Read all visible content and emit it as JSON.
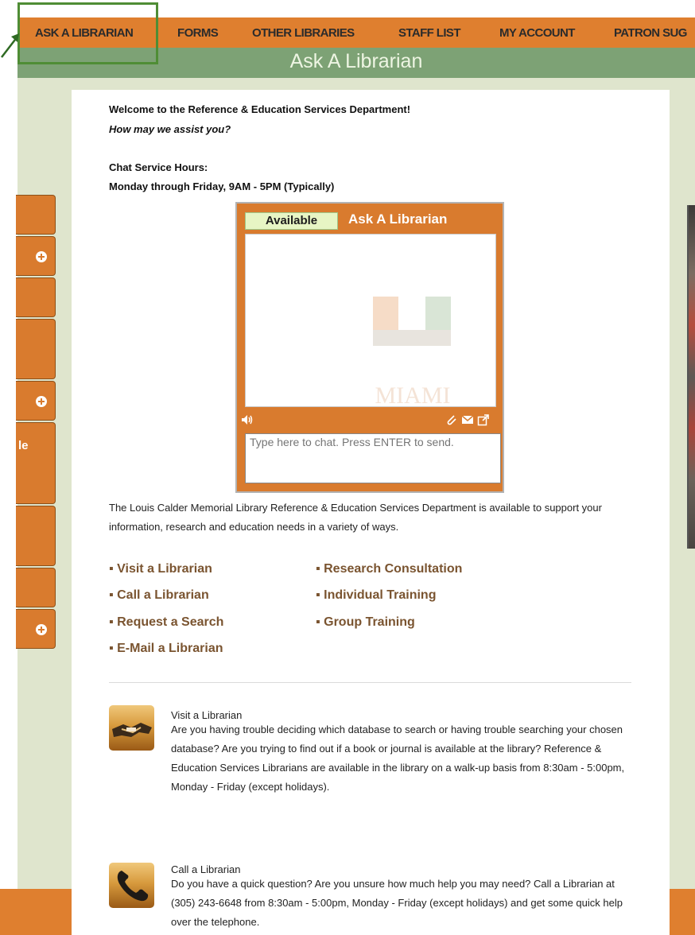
{
  "nav": {
    "items": [
      "ASK A LIBRARIAN",
      "FORMS",
      "OTHER LIBRARIES",
      "STAFF LIST",
      "MY ACCOUNT",
      "PATRON SUG"
    ]
  },
  "page": {
    "title": "Ask A Librarian"
  },
  "intro": {
    "welcome": "Welcome to the Reference & Education Services Department!",
    "assist": "How may we assist you?",
    "hours_label": "Chat Service Hours:",
    "hours_value": "Monday through Friday, 9AM - 5PM (Typically)"
  },
  "chat": {
    "status": "Available",
    "title": "Ask A Librarian",
    "watermark": "MIAMI",
    "input_placeholder": "Type here to chat. Press ENTER to send."
  },
  "description": "The Louis Calder Memorial Library Reference & Education Services Department is available to support your information, research and education needs in a variety of ways.",
  "services": {
    "left": [
      "Visit a Librarian",
      "Call a Librarian",
      "Request a Search",
      "E-Mail a Librarian"
    ],
    "right": [
      "Research Consultation",
      "Individual Training",
      "Group Training"
    ]
  },
  "sections": [
    {
      "title": "Visit a Librarian",
      "body": "Are you having trouble deciding which database to search or having trouble searching your chosen database? Are you trying to find out if a book or journal is available at the library? Reference & Education Services Librarians are available in the library on a walk-up basis from 8:30am - 5:00pm, Monday - Friday (except holidays).",
      "icon": "handshake-icon"
    },
    {
      "title": "Call a Librarian",
      "body": "Do you have a quick question? Are you unsure how much help you may need? Call a Librarian at (305) 243-6648 from 8:30am - 5:00pm, Monday - Friday (except holidays) and get some quick help over the telephone.",
      "icon": "phone-icon"
    }
  ],
  "sidebar": {
    "partial_label": "le"
  },
  "colors": {
    "nav_bg": "#df7f2f",
    "banner_bg": "#7da275",
    "page_bg": "#dfe5cd",
    "link": "#7a5430",
    "highlight": "#4f8d35"
  }
}
